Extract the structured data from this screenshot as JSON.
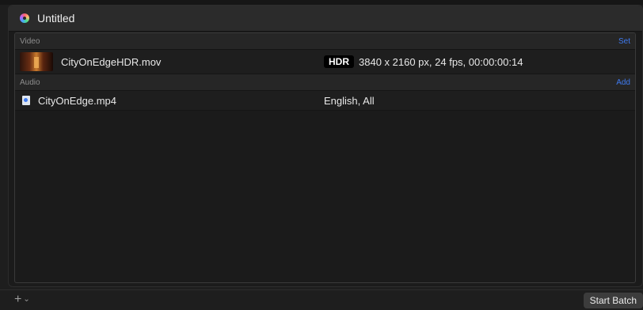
{
  "window": {
    "title": "Untitled"
  },
  "video": {
    "header": "Video",
    "action": "Set",
    "filename": "CityOnEdgeHDR.mov",
    "badge": "HDR",
    "info": "3840 x 2160 px, 24 fps, 00:00:00:14"
  },
  "audio": {
    "header": "Audio",
    "action": "Add",
    "filename": "CityOnEdge.mp4",
    "info": "English, All"
  },
  "bottom": {
    "add_icon": "plus-icon",
    "menu_icon": "chevron-down-icon",
    "start_label": "Start Batch"
  },
  "colors": {
    "accent": "#3f7af0",
    "background": "#1b1b1b"
  }
}
